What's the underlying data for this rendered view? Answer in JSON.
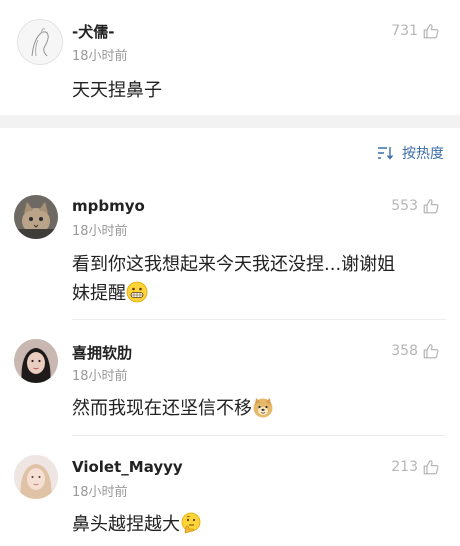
{
  "top_comment": {
    "name": "-犬儒-",
    "time": "18小时前",
    "likes": "731",
    "text": "天天捏鼻子"
  },
  "sort_label": "按热度",
  "comments": [
    {
      "name": "mpbmyo",
      "time": "18小时前",
      "likes": "553",
      "text_line1": "看到你这我想起来今天我还没捏...谢谢姐",
      "text_line2": "妹提醒",
      "emoji": "grinning-face-icon"
    },
    {
      "name": "喜拥软肋",
      "time": "18小时前",
      "likes": "358",
      "text": "然而我现在还坚信不移",
      "emoji": "doge-icon"
    },
    {
      "name": "Violet_Mayyy",
      "time": "18小时前",
      "likes": "213",
      "text": "鼻头越捏越大",
      "emoji": "thinking-face-icon"
    }
  ]
}
